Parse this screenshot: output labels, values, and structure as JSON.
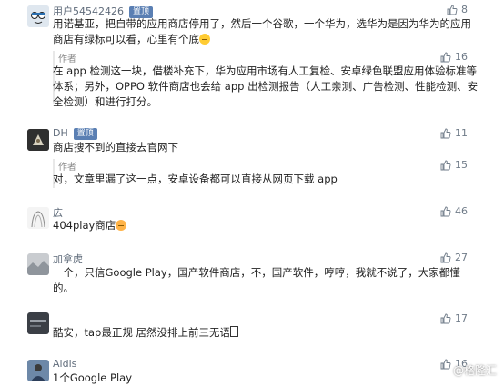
{
  "colors": {
    "pinned_badge": "#5a7fb3",
    "username": "#5f6b7a",
    "like_count": "#6f7b88"
  },
  "comments": [
    {
      "username": "用户54542426",
      "badge": "置顶",
      "likes": "8",
      "text": "用诺基亚，把自带的应用商店停用了，然后一个谷歌，一个华为，选华为是因为华为的应用商店有绿标可以看，心里有个底",
      "reply": {
        "tag": "作者",
        "likes": "16",
        "text": "在 app 检测这一块，借楼补充下，华为应用市场有人工复检、安卓绿色联盟应用体验标准等体系；另外，OPPO 软件商店也会给 app 出检测报告（人工亲测、广告检测、性能检测、安全检测）和进行打分。"
      }
    },
    {
      "username": "DH",
      "badge": "置顶",
      "likes": "11",
      "text": "商店搜不到的直接去官网下",
      "reply": {
        "tag": "作者",
        "likes": "15",
        "text": "对，文章里漏了这一点，安卓设备都可以直接从网页下载 app"
      }
    },
    {
      "username": "広",
      "likes": "46",
      "text": "404play商店"
    },
    {
      "username": "加拿虎",
      "likes": "27",
      "text": "一个，只信Google Play，国产软件商店，不，国产软件，哼哼，我就不说了，大家都懂的。"
    },
    {
      "username": "",
      "likes": "17",
      "text": "酷安，tap最正规 居然没排上前三无语"
    },
    {
      "username": "Aldis",
      "likes": "16",
      "text": "1个Google Play"
    }
  ],
  "watermark": "@格隆汇"
}
